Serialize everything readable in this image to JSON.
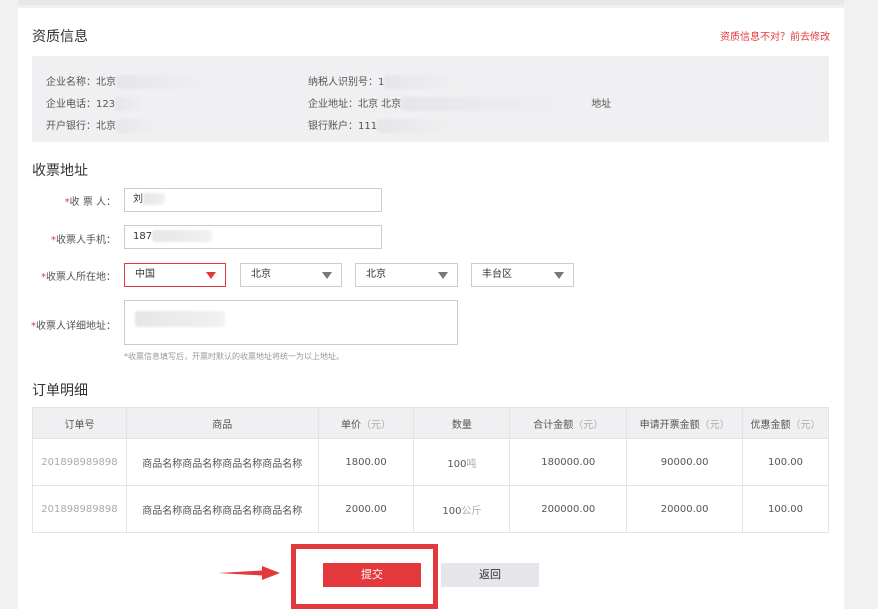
{
  "qualification": {
    "title": "资质信息",
    "edit_link": "资质信息不对？前去修改",
    "company_name": "企业名称：北京",
    "company_phone": "企业电话：123",
    "bank": "开户银行：北京",
    "tax_id": "纳税人识别号：1",
    "company_address": "企业地址：北京 北京",
    "company_address_tail": "地址",
    "bank_account": "银行账户：111"
  },
  "address": {
    "title": "收票地址",
    "receiver_label": "收 票 人：",
    "receiver_value": "刘",
    "phone_label": "收票人手机：",
    "phone_value": "187",
    "region_label": "收票人所在地：",
    "country": "中国",
    "province": "北京",
    "city": "北京",
    "district": "丰台区",
    "detail_label": "收票人详细地址：",
    "hint": "*收票信息填写后，开票时默认的收票地址将统一为以上地址。",
    "required_mark": "*"
  },
  "orders": {
    "title": "订单明细",
    "headers": {
      "order_no": "订单号",
      "product": "商品",
      "unit_price": "单价",
      "quantity": "数量",
      "total": "合计金额",
      "invoice_amount": "申请开票金额",
      "discount": "优惠金额",
      "unit_yuan": "（元）"
    },
    "rows": [
      {
        "order_no": "201898989898",
        "product": "商品名称商品名称商品名称商品名称",
        "unit_price": "1800.00",
        "qty_num": "100",
        "qty_unit": "吨",
        "total": "180000.00",
        "invoice_amount": "90000.00",
        "discount": "100.00"
      },
      {
        "order_no": "201898989898",
        "product": "商品名称商品名称商品名称商品名称",
        "unit_price": "2000.00",
        "qty_num": "100",
        "qty_unit": "公斤",
        "total": "200000.00",
        "invoice_amount": "20000.00",
        "discount": "100.00"
      }
    ]
  },
  "actions": {
    "submit": "提交",
    "back": "返回"
  },
  "colors": {
    "accent": "#e4393c"
  }
}
